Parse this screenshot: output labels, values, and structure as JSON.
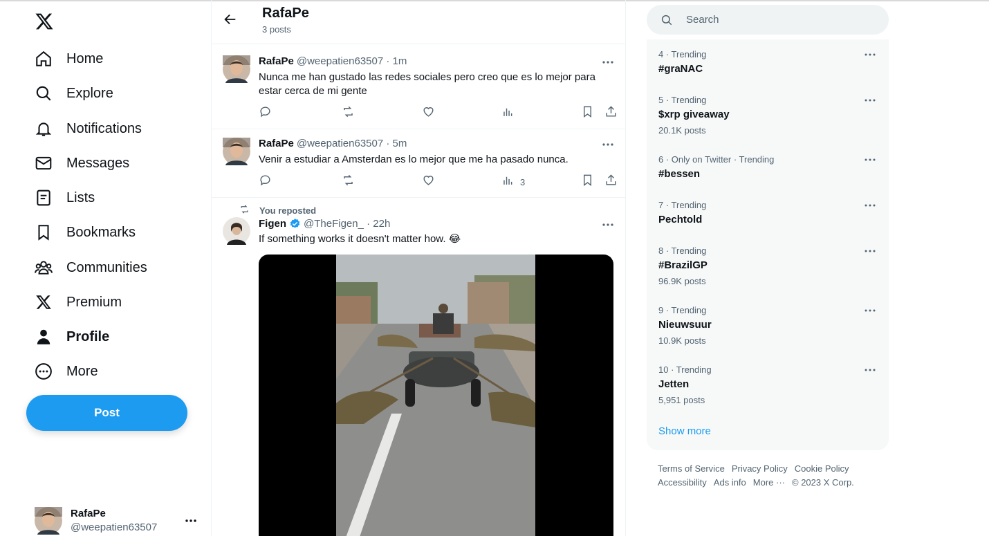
{
  "nav": {
    "items": [
      {
        "label": "Home",
        "icon": "home-icon"
      },
      {
        "label": "Explore",
        "icon": "search-icon"
      },
      {
        "label": "Notifications",
        "icon": "bell-icon"
      },
      {
        "label": "Messages",
        "icon": "envelope-icon"
      },
      {
        "label": "Lists",
        "icon": "list-icon"
      },
      {
        "label": "Bookmarks",
        "icon": "bookmark-icon"
      },
      {
        "label": "Communities",
        "icon": "people-icon"
      },
      {
        "label": "Premium",
        "icon": "x-logo-icon"
      },
      {
        "label": "Profile",
        "icon": "person-icon"
      },
      {
        "label": "More",
        "icon": "more-circle-icon"
      }
    ],
    "post_label": "Post",
    "account": {
      "name": "RafaPe",
      "handle": "@weepatien63507"
    }
  },
  "header": {
    "title": "RafaPe",
    "subtitle": "3 posts"
  },
  "tweets": [
    {
      "name": "RafaPe",
      "handle": "@weepatien63507 · 1m",
      "text": "Nunca me han gustado las redes sociales pero creo que es lo mejor para estar cerca de mi gente",
      "views": ""
    },
    {
      "name": "RafaPe",
      "handle": "@weepatien63507 · 5m",
      "text": "Venir a estudiar a Amsterdan es lo mejor que me ha pasado nunca.",
      "views": "3"
    },
    {
      "repost_note": "You reposted",
      "name": "Figen",
      "handle": "@TheFigen_ · 22h",
      "text": "If something works it doesn't matter how. 😂",
      "verified": true
    }
  ],
  "search": {
    "placeholder": "Search"
  },
  "trends": [
    {
      "meta": "4 · Trending",
      "title": "#graNAC",
      "posts": ""
    },
    {
      "meta": "5 · Trending",
      "title": "$xrp giveaway",
      "posts": "20.1K posts"
    },
    {
      "meta": "6 · Only on Twitter · Trending",
      "title": "#bessen",
      "posts": ""
    },
    {
      "meta": "7 · Trending",
      "title": "Pechtold",
      "posts": ""
    },
    {
      "meta": "8 · Trending",
      "title": "#BrazilGP",
      "posts": "96.9K posts"
    },
    {
      "meta": "9 · Trending",
      "title": "Nieuwsuur",
      "posts": "10.9K posts"
    },
    {
      "meta": "10 · Trending",
      "title": "Jetten",
      "posts": "5,951 posts"
    }
  ],
  "show_more": "Show more",
  "footer": {
    "links": [
      "Terms of Service",
      "Privacy Policy",
      "Cookie Policy",
      "Accessibility",
      "Ads info",
      "More ···",
      "© 2023 X Corp."
    ]
  },
  "colors": {
    "accent": "#1d9bf0",
    "text": "#0f1419",
    "muted": "#536471",
    "border": "#eff3f4"
  }
}
